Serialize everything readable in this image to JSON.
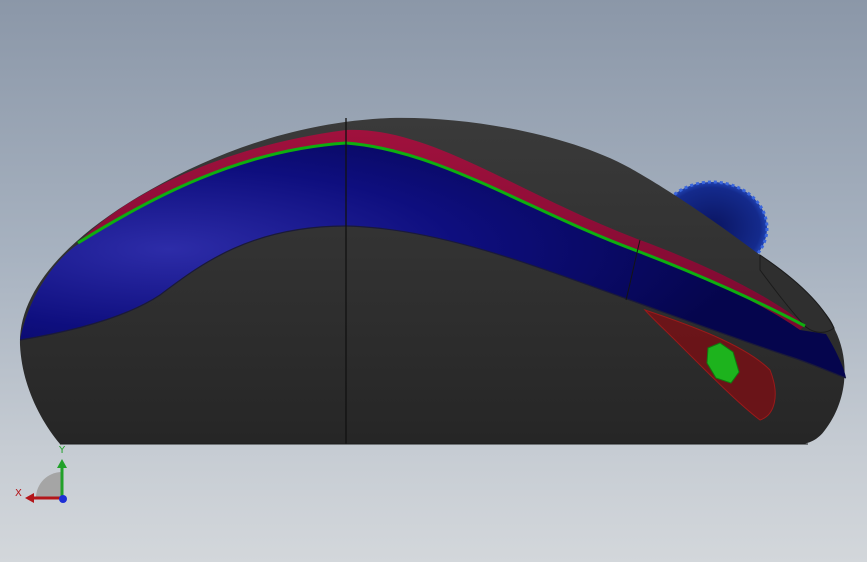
{
  "viewport": {
    "background_top": "#8b97a8",
    "background_bottom": "#d3d7db"
  },
  "model": {
    "body_color": "#2c2c2c",
    "upper_stripe_color": "#8c0a33",
    "lower_band_color": "#0b0b73",
    "parting_line_color": "#0fae0f",
    "scroll_wheel_color": "#112a8a",
    "internal_part_color": "#7a0f14",
    "sensor_color": "#1db31d"
  },
  "triad": {
    "x_label": "X",
    "y_label": "Y",
    "x_color": "#b3161a",
    "y_color": "#22a12a",
    "z_color": "#1d2fd6"
  }
}
